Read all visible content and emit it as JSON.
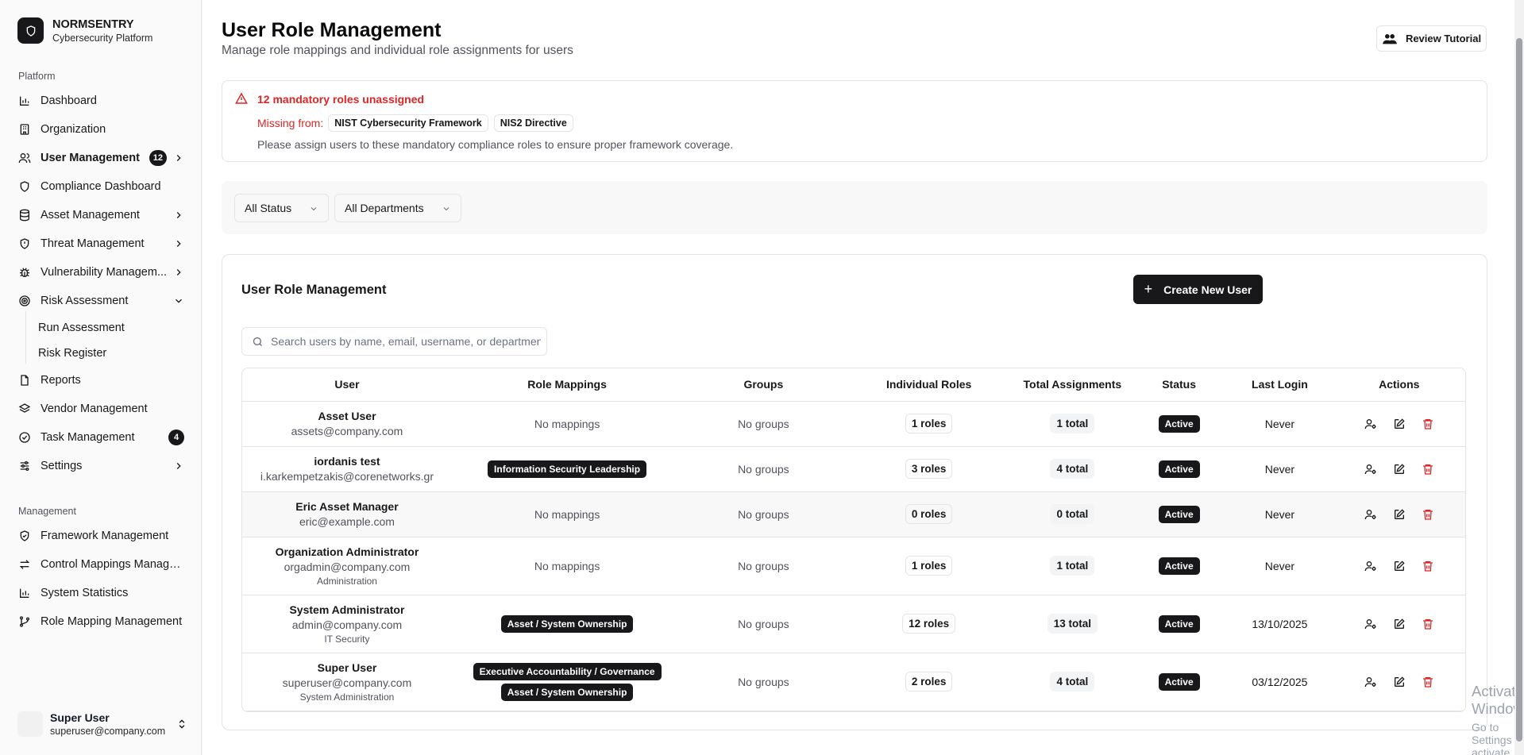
{
  "brand": {
    "name": "NORMSENTRY",
    "subtitle": "Cybersecurity Platform"
  },
  "sidebar": {
    "platform_label": "Platform",
    "items": [
      {
        "label": "Dashboard",
        "icon": "bar-chart-icon"
      },
      {
        "label": "Organization",
        "icon": "building-icon"
      },
      {
        "label": "User Management",
        "icon": "users-icon",
        "badge": "12",
        "active": true
      },
      {
        "label": "Compliance Dashboard",
        "icon": "shield-icon"
      },
      {
        "label": "Asset Management",
        "icon": "database-icon"
      },
      {
        "label": "Threat Management",
        "icon": "shield-alert-icon"
      },
      {
        "label": "Vulnerability Managem...",
        "icon": "bug-icon"
      },
      {
        "label": "Risk Assessment",
        "icon": "target-icon"
      },
      {
        "label": "Run Assessment"
      },
      {
        "label": "Risk Register"
      },
      {
        "label": "Reports",
        "icon": "file-icon"
      },
      {
        "label": "Vendor Management",
        "icon": "layers-icon"
      },
      {
        "label": "Task Management",
        "icon": "check-circle-icon",
        "badge": "4"
      },
      {
        "label": "Settings",
        "icon": "sliders-icon"
      }
    ],
    "management_label": "Management",
    "management_items": [
      {
        "label": "Framework Management",
        "icon": "shield-check-icon"
      },
      {
        "label": "Control Mappings Manage...",
        "icon": "arrows-icon"
      },
      {
        "label": "System Statistics",
        "icon": "bar-chart-icon"
      },
      {
        "label": "Role Mapping Management",
        "icon": "git-branch-icon"
      }
    ],
    "user": {
      "name": "Super User",
      "email": "superuser@company.com"
    }
  },
  "header": {
    "title": "User Role Management",
    "subtitle": "Manage role mappings and individual role assignments for users",
    "tutorial_label": "Review Tutorial"
  },
  "alert": {
    "title": "12 mandatory roles unassigned",
    "missing_label": "Missing from:",
    "frameworks": [
      "NIST Cybersecurity Framework",
      "NIS2 Directive"
    ],
    "note": "Please assign users to these mandatory compliance roles to ensure proper framework coverage."
  },
  "filters": {
    "status": "All Status",
    "department": "All Departments"
  },
  "card": {
    "title": "User Role Management",
    "create_label": "Create New User",
    "search_placeholder": "Search users by name, email, username, or department..."
  },
  "table": {
    "headers": [
      "User",
      "Role Mappings",
      "Groups",
      "Individual Roles",
      "Total Assignments",
      "Status",
      "Last Login",
      "Actions"
    ],
    "rows": [
      {
        "name": "Asset User",
        "email": "assets@company.com",
        "dept": "",
        "mappings_text": "No mappings",
        "mappings": [],
        "groups": "No groups",
        "roles": "1 roles",
        "total": "1 total",
        "status": "Active",
        "last_login": "Never"
      },
      {
        "name": "iordanis test",
        "email": "i.karkempetzakis@corenetworks.gr",
        "dept": "",
        "mappings_text": "",
        "mappings": [
          "Information Security Leadership"
        ],
        "groups": "No groups",
        "roles": "3 roles",
        "total": "4 total",
        "status": "Active",
        "last_login": "Never"
      },
      {
        "name": "Eric Asset Manager",
        "email": "eric@example.com",
        "dept": "",
        "mappings_text": "No mappings",
        "mappings": [],
        "groups": "No groups",
        "roles": "0 roles",
        "total": "0 total",
        "status": "Active",
        "last_login": "Never"
      },
      {
        "name": "Organization Administrator",
        "email": "orgadmin@company.com",
        "dept": "Administration",
        "mappings_text": "No mappings",
        "mappings": [],
        "groups": "No groups",
        "roles": "1 roles",
        "total": "1 total",
        "status": "Active",
        "last_login": "Never"
      },
      {
        "name": "System Administrator",
        "email": "admin@company.com",
        "dept": "IT Security",
        "mappings_text": "",
        "mappings": [
          "Asset / System Ownership"
        ],
        "groups": "No groups",
        "roles": "12 roles",
        "total": "13 total",
        "status": "Active",
        "last_login": "13/10/2025"
      },
      {
        "name": "Super User",
        "email": "superuser@company.com",
        "dept": "System Administration",
        "mappings_text": "",
        "mappings": [
          "Executive Accountability / Governance",
          "Asset / System Ownership"
        ],
        "groups": "No groups",
        "roles": "2 roles",
        "total": "4 total",
        "status": "Active",
        "last_login": "03/12/2025"
      }
    ]
  },
  "watermark": {
    "line1": "Activate Windows",
    "line2": "Go to Settings to activate Windows."
  },
  "colors": {
    "accent": "#18181b",
    "danger": "#dc2626",
    "muted": "#52525b"
  }
}
